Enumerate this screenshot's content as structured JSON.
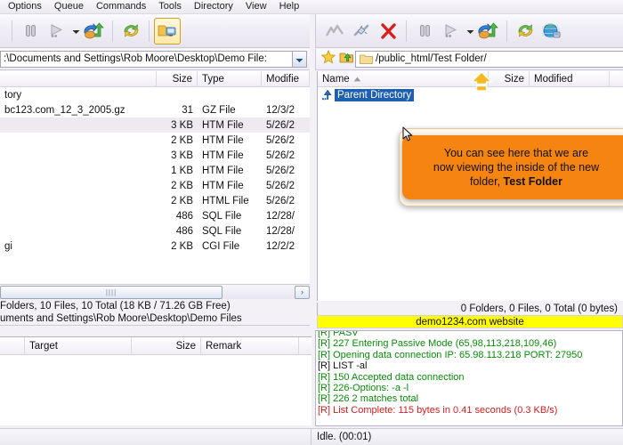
{
  "menubar": {
    "items": [
      {
        "label": "Options"
      },
      {
        "label": "Queue"
      },
      {
        "label": "Commands"
      },
      {
        "label": "Tools"
      },
      {
        "label": "Directory"
      },
      {
        "label": "View"
      },
      {
        "label": "Help"
      }
    ]
  },
  "toolbar_left": {
    "buttons": [
      {
        "name": "pause-button",
        "icon": "pause-icon",
        "title": "Pause"
      },
      {
        "name": "resume-button",
        "icon": "play-icon",
        "title": "Resume"
      },
      {
        "name": "resume-dropdown",
        "icon": "chevron-down-icon",
        "title": "Resume options"
      },
      {
        "name": "transfer-button",
        "icon": "transfer-arrows-icon",
        "title": "Transfer"
      },
      {
        "name": "refresh-button",
        "icon": "refresh-icon",
        "title": "Refresh"
      },
      {
        "name": "compare-folders-button",
        "icon": "compare-folders-icon",
        "title": "Compare Folders"
      }
    ]
  },
  "toolbar_right": {
    "buttons": [
      {
        "name": "graph-button",
        "icon": "chart-line-icon",
        "title": "Transfer Graph"
      },
      {
        "name": "disconnect-button",
        "icon": "broken-link-icon",
        "title": "Disconnect"
      },
      {
        "name": "stop-button",
        "icon": "red-x-icon",
        "title": "Stop"
      },
      {
        "name": "pause-button",
        "icon": "pause-icon",
        "title": "Pause"
      },
      {
        "name": "resume-button",
        "icon": "play-icon",
        "title": "Resume"
      },
      {
        "name": "resume-dropdown",
        "icon": "chevron-down-icon",
        "title": "Resume options"
      },
      {
        "name": "transfer-button",
        "icon": "transfer-arrows-icon",
        "title": "Transfer"
      },
      {
        "name": "refresh-button",
        "icon": "refresh-icon",
        "title": "Refresh"
      },
      {
        "name": "globe-button",
        "icon": "globe-icon",
        "title": "Global"
      }
    ]
  },
  "local": {
    "address": ":\\Documents and Settings\\Rob Moore\\Desktop\\Demo File:",
    "columns": [
      "",
      "Size",
      "Type",
      "Modifie"
    ],
    "rows": [
      {
        "name": "tory",
        "size": "",
        "type": "",
        "modified": ""
      },
      {
        "name": "bc123.com_12_3_2005.gz",
        "size": "31",
        "type": "GZ File",
        "modified": "12/3/2",
        "selected": false
      },
      {
        "name": "",
        "size": "3 KB",
        "type": "HTM File",
        "modified": "5/26/2",
        "selected": true
      },
      {
        "name": "",
        "size": "2 KB",
        "type": "HTM File",
        "modified": "5/26/2",
        "selected": false
      },
      {
        "name": "",
        "size": "3 KB",
        "type": "HTM File",
        "modified": "5/26/2",
        "selected": false
      },
      {
        "name": "",
        "size": "1 KB",
        "type": "HTM File",
        "modified": "5/26/2",
        "selected": false
      },
      {
        "name": "",
        "size": "2 KB",
        "type": "HTM File",
        "modified": "5/26/2",
        "selected": false
      },
      {
        "name": "",
        "size": "2 KB",
        "type": "HTML File",
        "modified": "5/26/2",
        "selected": false
      },
      {
        "name": "",
        "size": "486",
        "type": "SQL File",
        "modified": "12/28/",
        "selected": false
      },
      {
        "name": "",
        "size": "486",
        "type": "SQL File",
        "modified": "12/28/",
        "selected": false
      },
      {
        "name": "gi",
        "size": "2 KB",
        "type": "CGI File",
        "modified": "12/2/2",
        "selected": false
      }
    ],
    "status_counts": "Folders, 10 Files, 10 Total (18 KB / 71.26 GB Free)",
    "status_path": "uments and Settings\\Rob Moore\\Desktop\\Demo Files",
    "scroll_right_label": "›"
  },
  "remote": {
    "address": "/public_html/Test Folder/",
    "columns": [
      "Name",
      "Size",
      "Modified"
    ],
    "sort_indicator": "ascending",
    "rows": [
      {
        "name": "Parent Directory",
        "size": "",
        "modified": "",
        "selected": true,
        "icon": "up-folder-icon"
      }
    ],
    "status_counts": "0 Folders, 0 Files, 0 Total (0 bytes)",
    "site_label": "demo1234.com website",
    "favorites_icon": "star-icon",
    "uploadfolder_icon": "folder-up-icon",
    "path_icon": "folder-icon"
  },
  "queue": {
    "columns": [
      "",
      "Target",
      "Size",
      "Remark"
    ],
    "rows": []
  },
  "log": {
    "lines": [
      {
        "text": "[R] PASV",
        "color": "#0a8a0a",
        "clipped": true
      },
      {
        "text": "[R] 227 Entering Passive Mode (65,98,113,218,109,46)",
        "color": "#0a8a0a"
      },
      {
        "text": "[R] Opening data connection IP: 65.98.113.218 PORT: 27950",
        "color": "#0a8a0a"
      },
      {
        "text": "[R] LIST -al",
        "color": "#111111"
      },
      {
        "text": "[R] 150 Accepted data connection",
        "color": "#0a8a0a"
      },
      {
        "text": "[R] 226-Options: -a -l",
        "color": "#0a8a0a"
      },
      {
        "text": "[R] 226 2 matches total",
        "color": "#0a8a0a"
      },
      {
        "text": "[R] List Complete: 115 bytes in 0.41 seconds (0.3 KB/s)",
        "color": "#cc2222"
      }
    ]
  },
  "statusbar": {
    "status": "Idle. (00:01)"
  },
  "callout": {
    "line1": "You can see here that we are",
    "line2": "now viewing the inside of the new",
    "line3_prefix": "folder, ",
    "line3_bold": "Test Folder",
    "bg_color": "#f58410"
  },
  "annotation": {
    "arrow_color": "#f5b820",
    "arrow_name": "yellow-up-arrow-annotation"
  }
}
